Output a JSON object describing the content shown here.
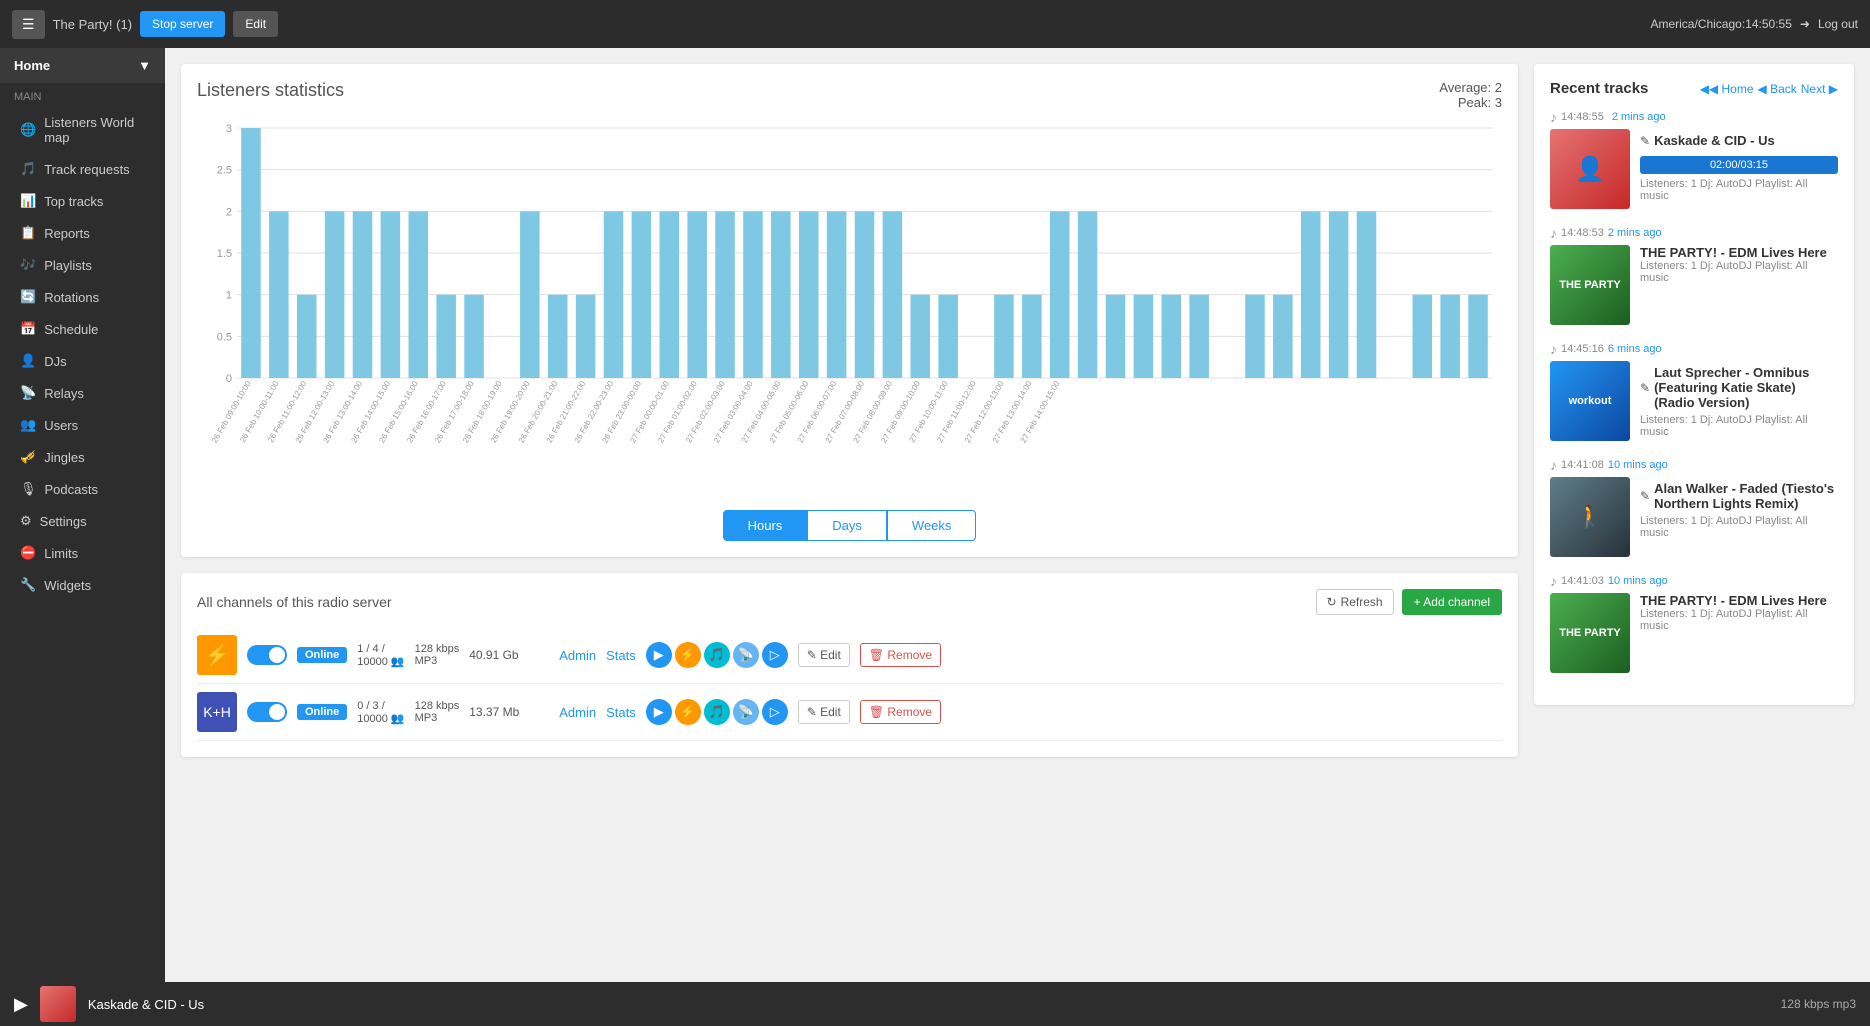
{
  "topbar": {
    "station": "The Party! (1)",
    "stop_label": "Stop server",
    "edit_label": "Edit",
    "timezone": "America/Chicago",
    "time": "14:50:55",
    "logout_label": "Log out"
  },
  "sidebar": {
    "home_label": "Home",
    "main_label": "Main",
    "items": [
      {
        "label": "Listeners World map",
        "icon": "🌐"
      },
      {
        "label": "Track requests",
        "icon": "🎵"
      },
      {
        "label": "Top tracks",
        "icon": "📊"
      },
      {
        "label": "Reports",
        "icon": "📋"
      },
      {
        "label": "Playlists",
        "icon": "🎶"
      },
      {
        "label": "Rotations",
        "icon": "🔄"
      },
      {
        "label": "Schedule",
        "icon": "📅"
      },
      {
        "label": "DJs",
        "icon": "👤"
      },
      {
        "label": "Relays",
        "icon": "📡"
      },
      {
        "label": "Users",
        "icon": "👥"
      },
      {
        "label": "Jingles",
        "icon": "🎺"
      },
      {
        "label": "Podcasts",
        "icon": "🎙"
      },
      {
        "label": "Settings",
        "icon": "⚙"
      },
      {
        "label": "Limits",
        "icon": "⛔"
      },
      {
        "label": "Widgets",
        "icon": "🔧"
      }
    ]
  },
  "chart": {
    "title": "Listeners statistics",
    "average_label": "Average:",
    "average_value": "2",
    "peak_label": "Peak:",
    "peak_value": "3",
    "tabs": [
      "Hours",
      "Days",
      "Weeks"
    ],
    "active_tab": 0,
    "bars": [
      3,
      2,
      1,
      2,
      2,
      2,
      2,
      1,
      1,
      0,
      2,
      1,
      1,
      2,
      2,
      2,
      2,
      2,
      2,
      2,
      2,
      2,
      2,
      2,
      1,
      1,
      0,
      1,
      1,
      2,
      2,
      1,
      1,
      1,
      1,
      0,
      1,
      1,
      2,
      2,
      2,
      0,
      1,
      1,
      1
    ],
    "labels": [
      "26 Feb 09:00-10:00",
      "26 Feb 10:00-11:00",
      "26 Feb 11:00-12:00",
      "26 Feb 12:00-13:00",
      "26 Feb 13:00-14:00",
      "26 Feb 14:00-15:00",
      "26 Feb 15:00-16:00",
      "26 Feb 16:00-17:00",
      "26 Feb 17:00-18:00",
      "26 Feb 18:00-19:00",
      "26 Feb 19:00-20:00",
      "26 Feb 20:00-21:00",
      "26 Feb 21:00-22:00",
      "26 Feb 22:00-23:00",
      "26 Feb 23:00-00:00",
      "27 Feb 00:00-01:00",
      "27 Feb 01:00-02:00",
      "27 Feb 02:00-03:00",
      "27 Feb 03:00-04:00",
      "27 Feb 04:00-05:00",
      "27 Feb 05:00-06:00",
      "27 Feb 06:00-07:00",
      "27 Feb 07:00-08:00",
      "27 Feb 08:00-09:00",
      "27 Feb 09:00-10:00",
      "27 Feb 10:00-11:00",
      "27 Feb 11:00-12:00",
      "27 Feb 12:00-13:00",
      "27 Feb 13:00-14:00",
      "27 Feb 14:00-15:00"
    ]
  },
  "channels": {
    "title": "All channels of this radio server",
    "refresh_label": "Refresh",
    "add_label": "+ Add channel",
    "rows": [
      {
        "icon": "🎵",
        "status": "Online",
        "stats": "1 / 4 /\n10000",
        "bitrate": "128 kbps\nMP3",
        "size": "40.91 Gb",
        "admin": "Admin",
        "stats_link": "Stats",
        "edit_label": "Edit",
        "remove_label": "Remove"
      },
      {
        "icon": "🎵",
        "status": "Online",
        "stats": "0 / 3 /\n10000",
        "bitrate": "128 kbps\nMP3",
        "size": "13.37 Mb",
        "admin": "Admin",
        "stats_link": "Stats",
        "edit_label": "Edit",
        "remove_label": "Remove"
      }
    ]
  },
  "recent_tracks": {
    "title": "Recent tracks",
    "nav": {
      "home": "◀◀ Home",
      "back": "◀ Back",
      "next": "Next ▶"
    },
    "tracks": [
      {
        "time": "14:48:55",
        "ago": "2 mins ago",
        "name": "Kaskade & CID - Us",
        "progress": "02:00/03:15",
        "progress_pct": 62,
        "listeners": "Listeners: 1",
        "dj": "Dj: AutoDJ",
        "playlist": "Playlist: All music",
        "color": "#e57373"
      },
      {
        "time": "14:48:53",
        "ago": "2 mins ago",
        "name": "THE PARTY! - EDM Lives Here",
        "progress": null,
        "progress_pct": 0,
        "listeners": "Listeners: 1",
        "dj": "Dj: AutoDJ",
        "playlist": "Playlist: All music",
        "color": "#4caf50"
      },
      {
        "time": "14:45:16",
        "ago": "6 mins ago",
        "name": "Laut Sprecher - Omnibus (Featuring Katie Skate) (Radio Version)",
        "progress": null,
        "progress_pct": 0,
        "listeners": "Listeners: 1",
        "dj": "Dj: AutoDJ",
        "playlist": "Playlist: All music",
        "color": "#2196F3"
      },
      {
        "time": "14:41:08",
        "ago": "10 mins ago",
        "name": "Alan Walker - Faded (Tiesto's Northern Lights Remix)",
        "progress": null,
        "progress_pct": 0,
        "listeners": "Listeners: 1",
        "dj": "Dj: AutoDJ",
        "playlist": "Playlist: All music",
        "color": "#607d8b"
      },
      {
        "time": "14:41:03",
        "ago": "10 mins ago",
        "name": "THE PARTY! - EDM Lives Here",
        "progress": null,
        "progress_pct": 0,
        "listeners": "Listeners: 1",
        "dj": "Dj: AutoDJ",
        "playlist": "Playlist: All music",
        "color": "#4caf50"
      }
    ]
  },
  "bottom_player": {
    "track": "Kaskade & CID - Us",
    "kbps": "128 kbps mp3"
  }
}
